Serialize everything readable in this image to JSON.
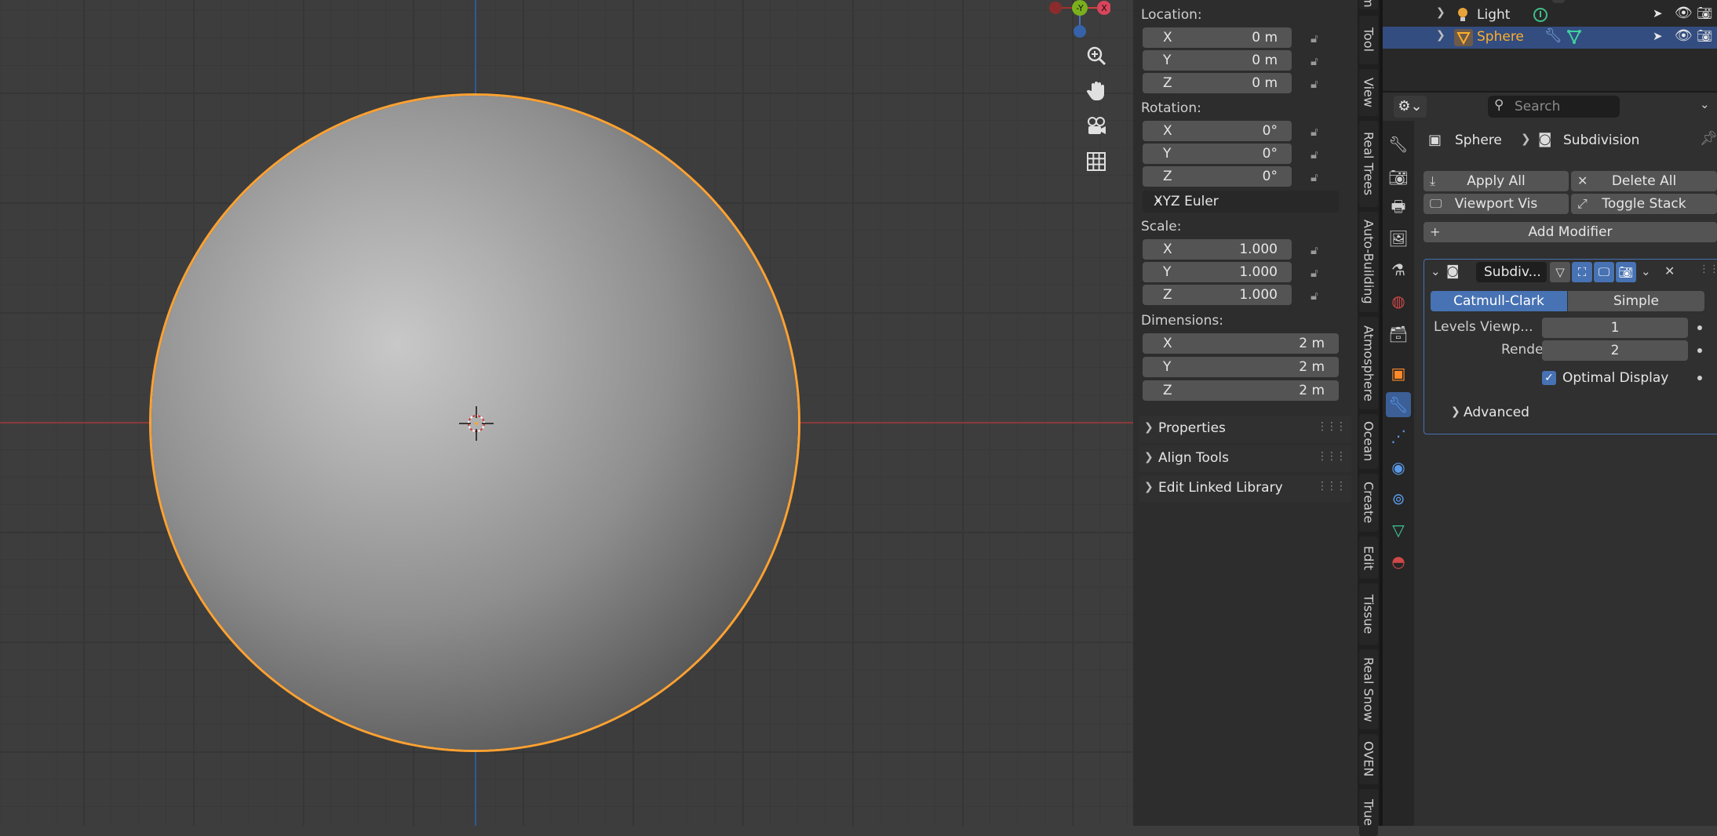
{
  "sidebar": {
    "location_label": "Location:",
    "location": [
      {
        "axis": "X",
        "value": "0 m"
      },
      {
        "axis": "Y",
        "value": "0 m"
      },
      {
        "axis": "Z",
        "value": "0 m"
      }
    ],
    "rotation_label": "Rotation:",
    "rotation": [
      {
        "axis": "X",
        "value": "0°"
      },
      {
        "axis": "Y",
        "value": "0°"
      },
      {
        "axis": "Z",
        "value": "0°"
      }
    ],
    "rotation_mode": "XYZ Euler",
    "scale_label": "Scale:",
    "scale": [
      {
        "axis": "X",
        "value": "1.000"
      },
      {
        "axis": "Y",
        "value": "1.000"
      },
      {
        "axis": "Z",
        "value": "1.000"
      }
    ],
    "dimensions_label": "Dimensions:",
    "dimensions": [
      {
        "axis": "X",
        "value": "2 m"
      },
      {
        "axis": "Y",
        "value": "2 m"
      },
      {
        "axis": "Z",
        "value": "2 m"
      }
    ],
    "panels": [
      "Properties",
      "Align Tools",
      "Edit Linked Library"
    ]
  },
  "tabs": [
    "Tool",
    "View",
    "Real Trees",
    "Auto-Building",
    "Atmosphere",
    "Ocean",
    "Create",
    "Edit",
    "Tissue",
    "Real Snow",
    "OVEN",
    "True"
  ],
  "tabs_top_partial": "m",
  "outliner": {
    "rows": [
      {
        "name": "Light",
        "color": "#e6e6e6",
        "selected": false
      },
      {
        "name": "Sphere",
        "color": "#ffaf29",
        "selected": true
      }
    ]
  },
  "properties": {
    "search_placeholder": "Search",
    "breadcrumb": {
      "object": "Sphere",
      "modifier": "Subdivision"
    },
    "apply_all": "Apply All",
    "delete_all": "Delete All",
    "viewport_vis": "Viewport Vis",
    "toggle_stack": "Toggle Stack",
    "add_modifier": "Add Modifier",
    "modifier": {
      "name": "Subdiv...",
      "catmull_clark": "Catmull-Clark",
      "simple": "Simple",
      "levels_viewport_label": "Levels Viewp...",
      "levels_viewport": "1",
      "render_label": "Render",
      "render": "2",
      "optimal_display": "Optimal Display",
      "optimal_display_checked": true,
      "advanced": "Advanced"
    }
  },
  "gizmo": {
    "y_label": "-Y",
    "x_label": "X"
  },
  "colors": {
    "selection_outline": "#ffa232",
    "active_blue": "#4772b3",
    "x_axis": "#8a3a3a",
    "y_axis": "#2f5a94"
  }
}
